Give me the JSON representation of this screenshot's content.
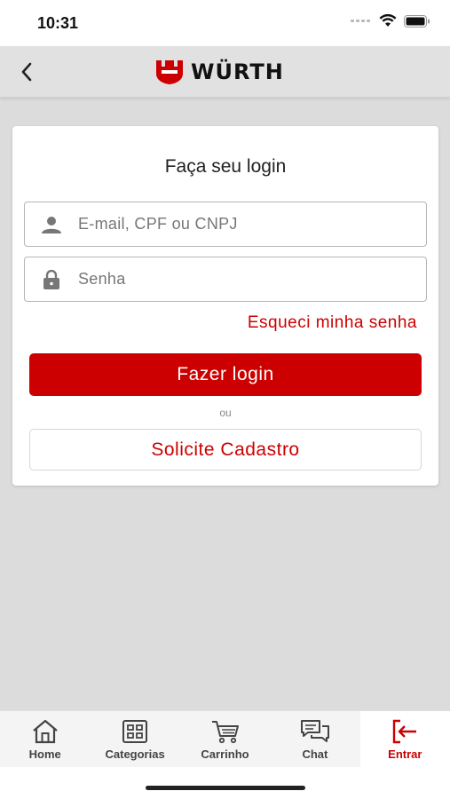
{
  "status_bar": {
    "time": "10:31"
  },
  "header": {
    "brand_name": "WÜRTH"
  },
  "login_card": {
    "title": "Faça seu login",
    "email_placeholder": "E-mail, CPF ou CNPJ",
    "password_placeholder": "Senha",
    "forgot_password": "Esqueci minha senha",
    "login_button": "Fazer login",
    "or_separator": "ou",
    "register_button": "Solicite Cadastro"
  },
  "bottom_nav": {
    "items": [
      {
        "label": "Home",
        "icon": "home-icon"
      },
      {
        "label": "Categorias",
        "icon": "grid-icon"
      },
      {
        "label": "Carrinho",
        "icon": "cart-icon"
      },
      {
        "label": "Chat",
        "icon": "chat-icon"
      },
      {
        "label": "Entrar",
        "icon": "login-icon",
        "active": true
      }
    ]
  },
  "colors": {
    "brand_red": "#cc0000",
    "background": "#dcdcdc",
    "header_bg": "#e1e1e1"
  }
}
